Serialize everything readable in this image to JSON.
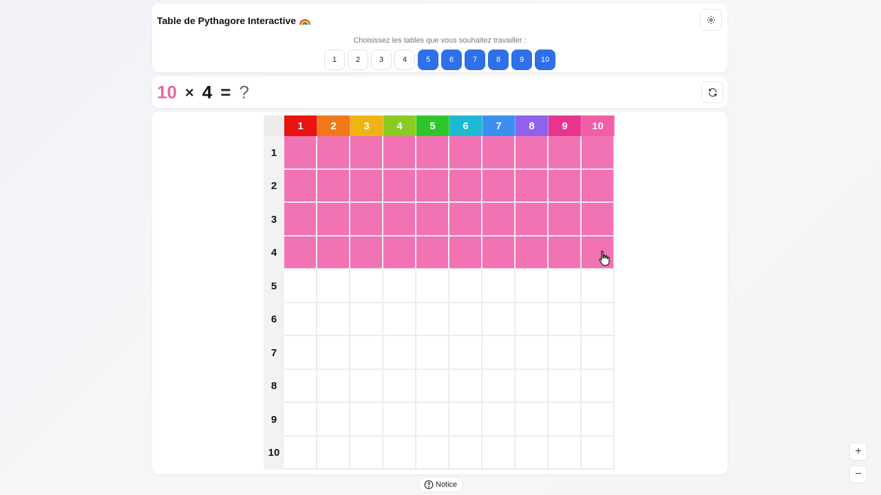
{
  "header": {
    "title": "Table de Pythagore Interactive",
    "title_icon": "rainbow-icon",
    "settings_icon": "gear-icon",
    "choose_label": "Choisissez les tables que vous souhaitez travailler :",
    "tables": [
      {
        "label": "1",
        "active": false
      },
      {
        "label": "2",
        "active": false
      },
      {
        "label": "3",
        "active": false
      },
      {
        "label": "4",
        "active": false
      },
      {
        "label": "5",
        "active": true
      },
      {
        "label": "6",
        "active": true
      },
      {
        "label": "7",
        "active": true
      },
      {
        "label": "8",
        "active": true
      },
      {
        "label": "9",
        "active": true
      },
      {
        "label": "10",
        "active": true
      }
    ]
  },
  "question": {
    "a": "10",
    "op": "×",
    "b": "4",
    "eq": "=",
    "answer": "?",
    "refresh_icon": "refresh-icon"
  },
  "grid": {
    "columns": [
      "1",
      "2",
      "3",
      "4",
      "5",
      "6",
      "7",
      "8",
      "9",
      "10"
    ],
    "rows": [
      "1",
      "2",
      "3",
      "4",
      "5",
      "6",
      "7",
      "8",
      "9",
      "10"
    ],
    "column_colors": [
      "#e81313",
      "#f07818",
      "#efb413",
      "#8acb21",
      "#2ec42c",
      "#1db8d2",
      "#3c8fef",
      "#8f61ee",
      "#e8338f",
      "#f05fa6"
    ],
    "fill_color": "#f173b4",
    "filled_rows": 4,
    "filled_cols": 10
  },
  "footer": {
    "notice_label": "Notice",
    "notice_icon": "help-circle-icon",
    "zoom_in_label": "+",
    "zoom_out_label": "−"
  }
}
